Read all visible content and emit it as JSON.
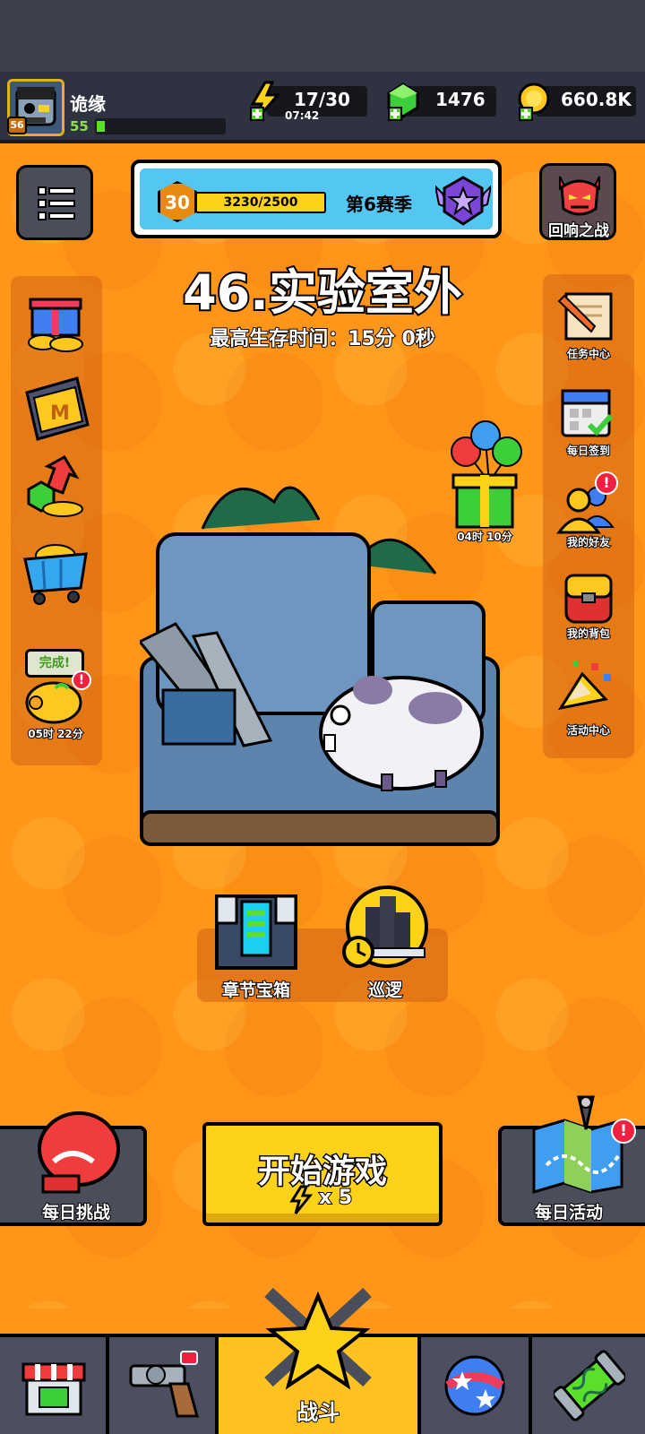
{
  "player": {
    "name": "诡缘",
    "level": "55",
    "avatar_level": "56",
    "xp_fraction": 0.06
  },
  "resources": {
    "energy": "17/30",
    "energy_timer": "07:42",
    "gems": "1476",
    "coins": "660.8K"
  },
  "season": {
    "level": "30",
    "progress_text": "3230/2500",
    "title": "第6赛季"
  },
  "echo_battle": {
    "label": "回响之战"
  },
  "stage": {
    "title": "46.实验室外",
    "best_time": "最高生存时间：15分 0秒"
  },
  "right_menu": [
    {
      "label": "任务中心",
      "icon": "scroll-pencil-icon"
    },
    {
      "label": "每日签到",
      "icon": "calendar-check-icon"
    },
    {
      "label": "我的好友",
      "icon": "friends-icon",
      "alert": "!"
    },
    {
      "label": "我的背包",
      "icon": "backpack-icon"
    },
    {
      "label": "活动中心",
      "icon": "party-popper-icon"
    }
  ],
  "left_menu": [
    {
      "icon": "gift-coins-icon"
    },
    {
      "icon": "monthly-card-icon"
    },
    {
      "icon": "gem-growth-icon"
    },
    {
      "icon": "shop-cart-icon"
    }
  ],
  "piggy": {
    "bubble": "完成!",
    "timer": "05时 22分",
    "alert": "!"
  },
  "balloon_gift": {
    "timer": "04时 10分"
  },
  "chapter_chest": {
    "label": "章节宝箱"
  },
  "patrol": {
    "label": "巡逻"
  },
  "daily_challenge": {
    "label": "每日挑战"
  },
  "start_game": {
    "label": "开始游戏",
    "cost": "x 5"
  },
  "daily_activity": {
    "label": "每日活动",
    "alert": "!"
  },
  "nav": {
    "battle_label": "战斗",
    "tabs": [
      "shop-icon",
      "weapon-icon",
      "talent-ball-icon",
      "gene-capsule-icon"
    ]
  },
  "colors": {
    "bg": "#ff9619",
    "hud": "#2f3240",
    "accent_yellow": "#ffd21a",
    "season_blue": "#54c6f2"
  }
}
